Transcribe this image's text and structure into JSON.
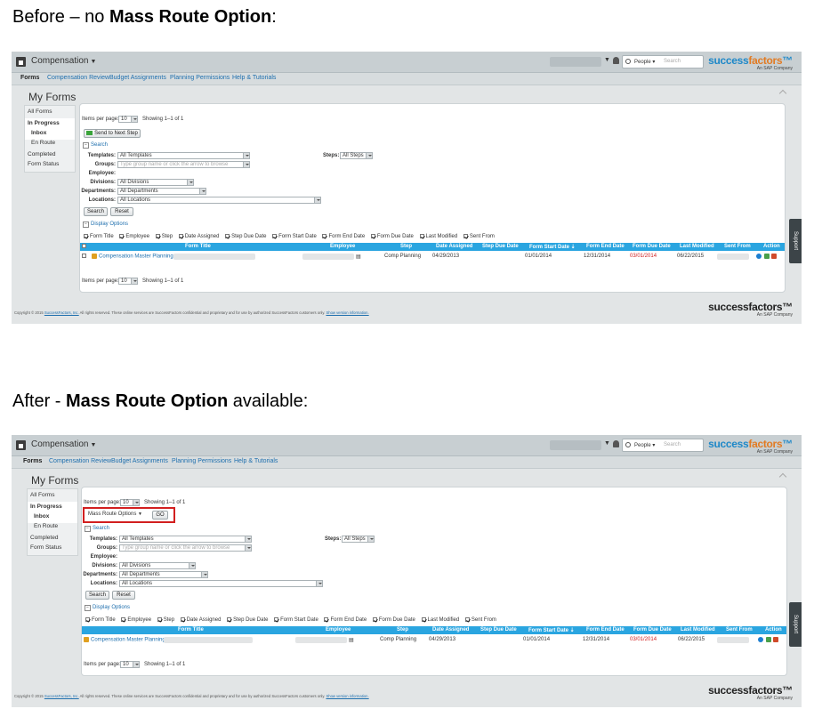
{
  "captions": {
    "before_prefix": "Before – no ",
    "before_bold": "Mass Route Option",
    "before_suffix": ":",
    "after_prefix": "After - ",
    "after_bold": "Mass Route Option",
    "after_suffix": " available:"
  },
  "app": {
    "module": "Compensation",
    "search_scope": "People",
    "search_placeholder": "Search",
    "logo_a": "success",
    "logo_b": "factors",
    "logo_sub": "An SAP Company",
    "footer_logo": "successfactors",
    "support_tab": "Support",
    "nav": [
      "Forms",
      "Compensation Review",
      "Budget Assignments",
      "Planning Permissions",
      "Help & Tutorials"
    ],
    "page_title": "My Forms",
    "left_nav": {
      "all_forms": "All Forms",
      "in_progress": "In Progress",
      "inbox": "Inbox",
      "en_route": "En Route",
      "completed": "Completed",
      "form_status": "Form Status"
    },
    "items_per_page_label": "Items per page:",
    "items_per_page_value": "10",
    "showing": "Showing 1–1 of 1",
    "send_next_step": "Send to Next Step",
    "mass_route_select": "Mass Route Options",
    "go_button": "GO",
    "search_section": "Search",
    "filters": {
      "templates_label": "Templates:",
      "templates_value": "All Templates",
      "groups_label": "Groups:",
      "groups_placeholder": "Type group name or click the arrow to browse",
      "employee_label": "Employee:",
      "divisions_label": "Divisions:",
      "divisions_value": "All Divisions",
      "departments_label": "Departments:",
      "departments_value": "All Departments",
      "locations_label": "Locations:",
      "locations_value": "All Locations",
      "steps_label": "Steps:",
      "steps_value": "All Steps"
    },
    "search_button": "Search",
    "reset_button": "Reset",
    "display_options_section": "Display Options",
    "display_options": [
      "Form Title",
      "Employee",
      "Step",
      "Date Assigned",
      "Step Due Date",
      "Form Start Date",
      "Form End Date",
      "Form Due Date",
      "Last Modified",
      "Sent From"
    ],
    "table_headers": [
      "Form Title",
      "Employee",
      "Step",
      "Date Assigned",
      "Step Due Date",
      "Form Start Date",
      "Form End Date",
      "Form Due Date",
      "Last Modified",
      "Sent From",
      "Action"
    ],
    "row": {
      "form_title": "Compensation Master Planning",
      "step": "Comp Planning",
      "date_assigned": "04/29/2013",
      "form_start_date": "01/01/2014",
      "form_end_date": "12/31/2014",
      "form_due_date": "03/01/2014",
      "last_modified": "06/22/2015"
    },
    "footer_text_a": "Copyright © 2015 ",
    "footer_link_a": "SuccessFactors, Inc.",
    "footer_text_b": " All rights reserved. These online services are SuccessFactors confidential and proprietary and for use by authorized SuccessFactors customers only. ",
    "footer_link_b": "Show version information."
  },
  "colors": {
    "accent": "#2aa5e0",
    "link": "#1e6fae",
    "highlight": "#d21f1f",
    "due_date": "#d02020"
  }
}
